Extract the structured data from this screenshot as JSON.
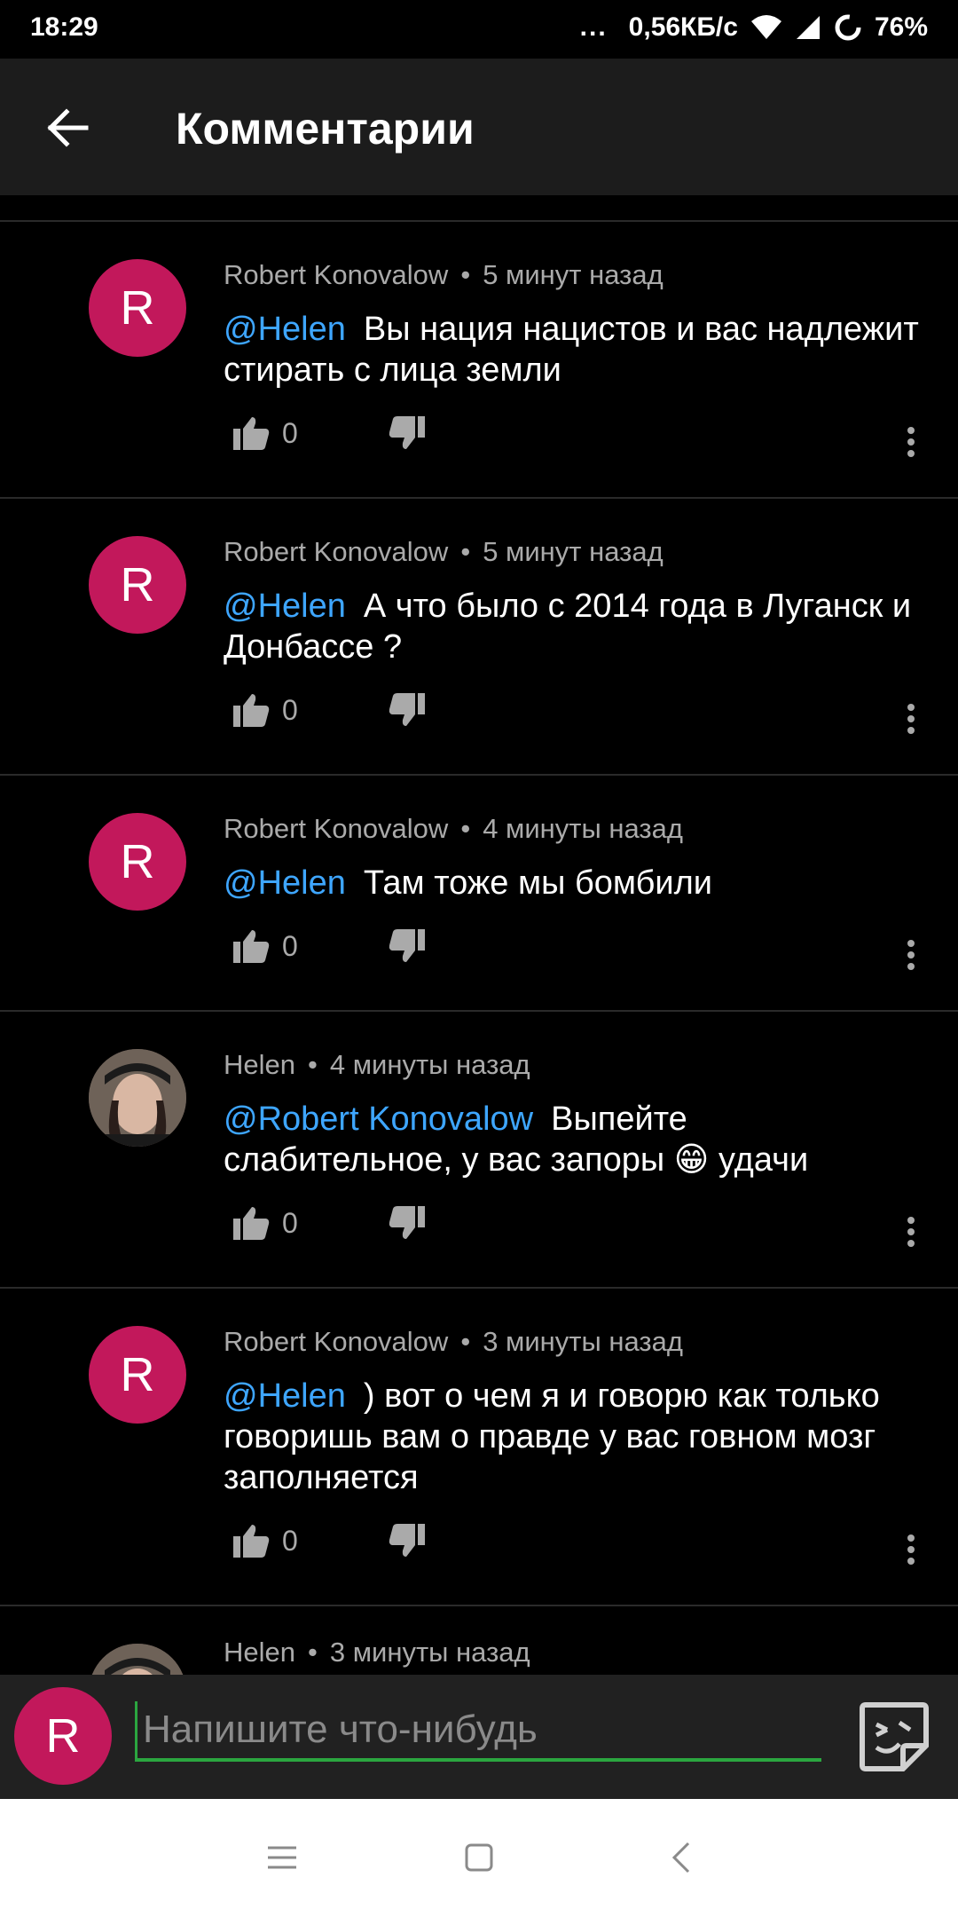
{
  "status_bar": {
    "time": "18:29",
    "dots": "...",
    "network_speed": "0,56КБ/с",
    "battery": "76%"
  },
  "appbar": {
    "title": "Комментарии"
  },
  "comments": [
    {
      "avatar_letter": "R",
      "author": "Robert Konovalow",
      "separator": "•",
      "time": "5 минут назад",
      "mention": "@Helen",
      "text": "Вы нация нацистов и вас надлежит стирать с лица земли",
      "likes": "0"
    },
    {
      "avatar_letter": "R",
      "author": "Robert Konovalow",
      "separator": "•",
      "time": "5 минут назад",
      "mention": "@Helen",
      "text": "А что было с 2014 года в Луганск и Донбассе ?",
      "likes": "0"
    },
    {
      "avatar_letter": "R",
      "author": "Robert Konovalow",
      "separator": "•",
      "time": "4 минуты назад",
      "mention": "@Helen",
      "text": "Там тоже мы бомбили",
      "likes": "0"
    },
    {
      "avatar_letter": "",
      "author": "Helen",
      "separator": "•",
      "time": "4 минуты назад",
      "mention": "@Robert Konovalow",
      "text": "Выпейте слабительное, у вас запоры 😁 удачи",
      "likes": "0"
    },
    {
      "avatar_letter": "R",
      "author": "Robert Konovalow",
      "separator": "•",
      "time": "3 минуты назад",
      "mention": "@Helen",
      "text": ") вот о чем я и говорю как только говоришь вам о правде у вас говном мозг заполняется",
      "likes": "0"
    },
    {
      "avatar_letter": "",
      "author": "Helen",
      "separator": "•",
      "time": "3 минуты назад"
    }
  ],
  "composer": {
    "avatar_letter": "R",
    "placeholder": "Напишите что-нибудь"
  },
  "colors": {
    "background": "#000000",
    "appbar": "#1c1c1c",
    "avatar": "#c2185b",
    "mention": "#3ea6ff",
    "input_underline": "#2ba640"
  },
  "icons": {
    "back": "arrow-left-icon",
    "like": "thumb-up-icon",
    "dislike": "thumb-down-icon",
    "more": "more-vertical-icon",
    "sticker": "sticker-icon",
    "nav_menu": "menu-icon",
    "nav_home": "home-icon",
    "nav_back": "back-chevron-icon"
  }
}
